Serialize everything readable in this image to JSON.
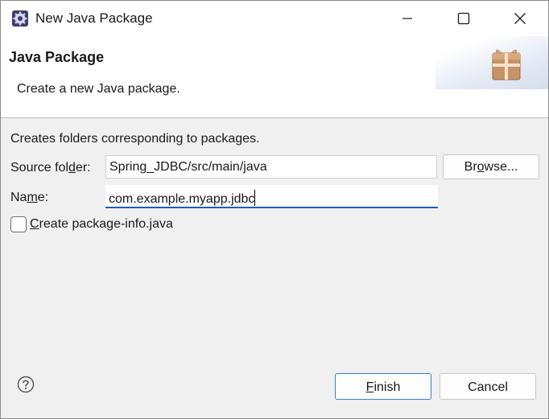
{
  "window": {
    "title": "New Java Package"
  },
  "banner": {
    "title": "Java Package",
    "description": "Create a new Java package."
  },
  "form": {
    "hint": "Creates folders corresponding to packages.",
    "source_folder": {
      "label_pre": "Source fol",
      "label_mnemonic": "d",
      "label_post": "er:",
      "value": "Spring_JDBC/src/main/java"
    },
    "name": {
      "label_pre": "Na",
      "label_mnemonic": "m",
      "label_post": "e:",
      "value": "com.example.myapp.jdbc"
    },
    "browse_button": {
      "pre": "Br",
      "mnemonic": "o",
      "post": "wse..."
    },
    "create_package_info": {
      "mnemonic": "C",
      "post": "reate package-info.java",
      "checked": false
    }
  },
  "footer": {
    "finish": {
      "mnemonic": "F",
      "post": "inish"
    },
    "cancel": "Cancel"
  },
  "icons": {
    "app": "eclipse-gear-icon",
    "banner": "package-box-icon",
    "help": "help-question-icon",
    "minimize": "minimize-icon",
    "maximize": "maximize-icon",
    "close": "close-icon"
  },
  "colors": {
    "accent": "#1a5fb4",
    "dialog_bg": "#f0f0f0",
    "package_icon": "#c8926a"
  }
}
